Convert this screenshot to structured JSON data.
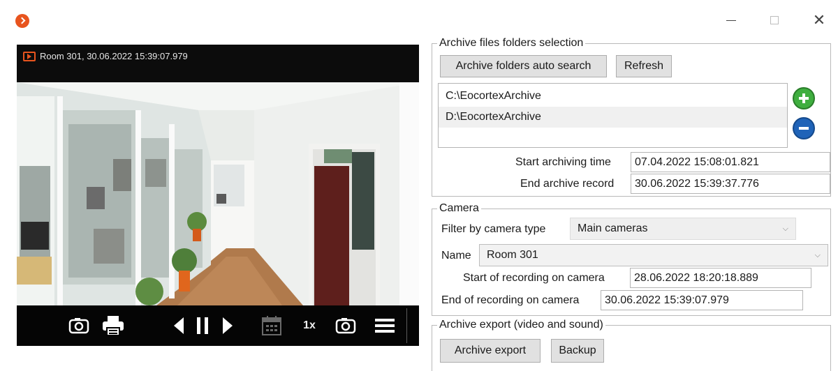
{
  "window": {
    "logo_color": "#e8541e",
    "minimize_icon": "minimize-icon",
    "maximize_icon": "maximize-icon",
    "close_icon": "close-icon",
    "close_glyph": "✕"
  },
  "video": {
    "caption": "Room 301, 30.06.2022 15:39:07.979",
    "controls": {
      "speed": "1x",
      "icons": [
        "snapshot-icon",
        "print-icon",
        "step-back-icon",
        "pause-icon",
        "step-forward-icon",
        "calendar-icon",
        "snapshot-icon",
        "menu-icon"
      ]
    }
  },
  "archive_folders": {
    "legend": "Archive files folders selection",
    "auto_search_button": "Archive folders auto search",
    "refresh_button": "Refresh",
    "folders": [
      "C:\\EocortexArchive",
      "D:\\EocortexArchive"
    ],
    "selected_index": 1,
    "start_archiving_label": "Start archiving time",
    "start_archiving_value": "07.04.2022 15:08:01.821",
    "end_archive_label": "End archive record",
    "end_archive_value": "30.06.2022 15:39:37.776",
    "add_color": "#3fae3f",
    "remove_color": "#1f63b8"
  },
  "camera": {
    "legend": "Camera",
    "filter_label": "Filter by camera type",
    "filter_value": "Main cameras",
    "name_label": "Name",
    "name_value": "Room 301",
    "start_recording_label": "Start of recording on camera",
    "start_recording_value": "28.06.2022 18:20:18.889",
    "end_recording_label": "End of recording on camera",
    "end_recording_value": "30.06.2022 15:39:07.979"
  },
  "export": {
    "legend": "Archive export (video and sound)",
    "archive_export_button": "Archive export",
    "backup_button": "Backup"
  }
}
